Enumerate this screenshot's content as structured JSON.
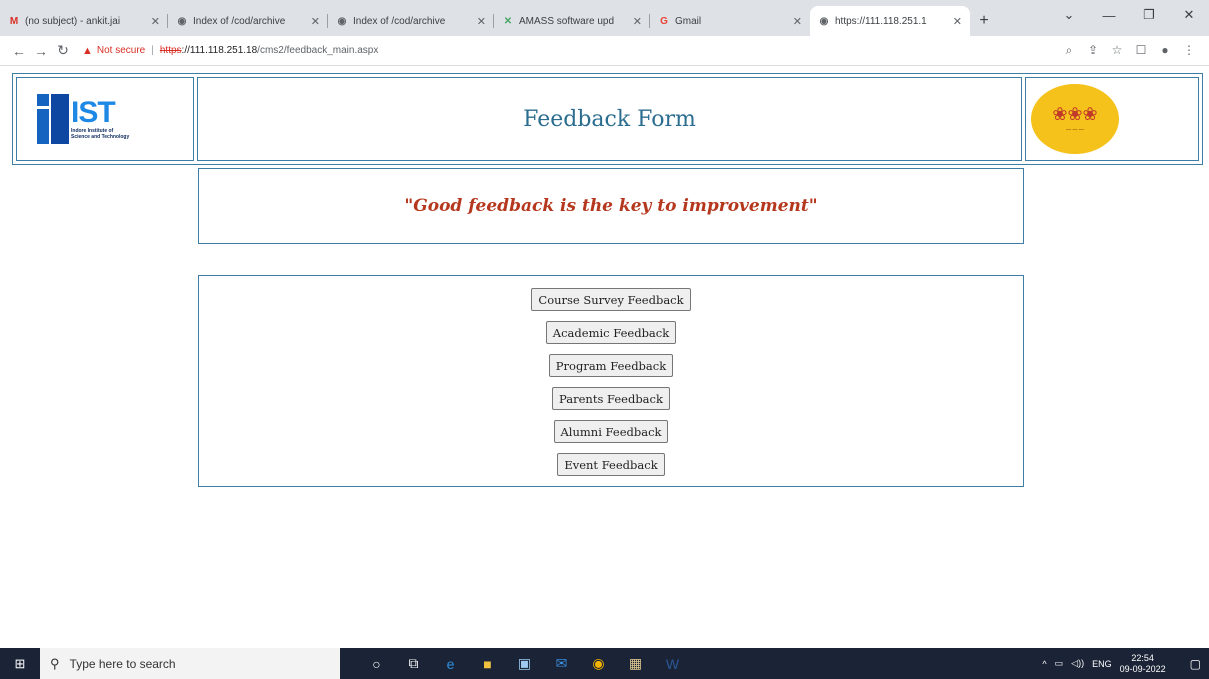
{
  "browser": {
    "tabs": [
      {
        "title": "(no subject) - ankit.jai",
        "icon": "gmail-icon",
        "glyph": "M",
        "color": "#d93025"
      },
      {
        "title": "Index of /cod/archive",
        "icon": "globe-icon",
        "glyph": "◉",
        "color": "#5f6368"
      },
      {
        "title": "Index of /cod/archive",
        "icon": "globe-icon",
        "glyph": "◉",
        "color": "#5f6368"
      },
      {
        "title": "AMASS software upd",
        "icon": "amass-icon",
        "glyph": "✕",
        "color": "#4aa564"
      },
      {
        "title": "Gmail",
        "icon": "google-icon",
        "glyph": "G",
        "color": "#ea4335"
      },
      {
        "title": "https://111.118.251.1",
        "icon": "globe-icon",
        "glyph": "◉",
        "color": "#5f6368"
      }
    ],
    "new_tab": "+",
    "address": {
      "warning": "Not secure",
      "scheme": "https",
      "host": "://111.118.251.18",
      "path": "/cms2/feedback_main.aspx"
    }
  },
  "page": {
    "logo_abbr": "IST",
    "logo_name_line1": "Indore Institute of",
    "logo_name_line2": "Science and Technology",
    "title": "Feedback Form",
    "quote": "\"Good feedback is the key to improvement\"",
    "buttons": [
      "Course Survey Feedback",
      "Academic Feedback",
      "Program Feedback",
      "Parents Feedback",
      "Alumni Feedback",
      "Event Feedback"
    ]
  },
  "taskbar": {
    "search_placeholder": "Type here to search",
    "language": "ENG",
    "time": "22:54",
    "date": "09-09-2022"
  },
  "colors": {
    "border": "#3e7ea6",
    "title": "#2b6d8f",
    "quote": "#b5381e"
  }
}
